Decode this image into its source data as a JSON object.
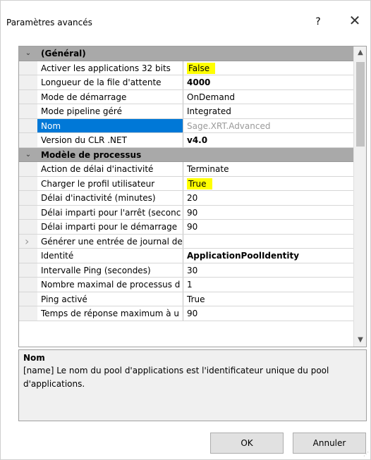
{
  "window": {
    "title": "Paramètres avancés",
    "help_label": "?",
    "close_label": "✕"
  },
  "grid": {
    "sections": [
      {
        "category": "(Général)",
        "expanded": true,
        "rows": [
          {
            "name": "Activer les applications 32 bits",
            "value": "False",
            "highlighted": true
          },
          {
            "name": "Longueur de la file d'attente",
            "value": "4000",
            "bold": true
          },
          {
            "name": "Mode de démarrage",
            "value": "OnDemand"
          },
          {
            "name": "Mode pipeline géré",
            "value": "Integrated"
          },
          {
            "name": "Nom",
            "value": "Sage.XRT.Advanced",
            "selected": true,
            "disabled": true
          },
          {
            "name": "Version du CLR .NET",
            "value": "v4.0",
            "bold": true
          }
        ]
      },
      {
        "category": "Modèle de processus",
        "expanded": true,
        "rows": [
          {
            "name": "Action de délai d'inactivité",
            "value": "Terminate"
          },
          {
            "name": "Charger le profil utilisateur",
            "value": "True",
            "highlighted": true
          },
          {
            "name": "Délai d'inactivité (minutes)",
            "value": "20"
          },
          {
            "name": "Délai imparti pour l'arrêt (seconc",
            "value": "90"
          },
          {
            "name": "Délai imparti pour le démarrage",
            "value": "90"
          },
          {
            "name": "Générer une entrée de journal de",
            "value": "",
            "expander": true
          },
          {
            "name": "Identité",
            "value": "ApplicationPoolIdentity",
            "bold": true
          },
          {
            "name": "Intervalle Ping (secondes)",
            "value": "30"
          },
          {
            "name": "Nombre maximal de processus d",
            "value": "1"
          },
          {
            "name": "Ping activé",
            "value": "True"
          },
          {
            "name": "Temps de réponse maximum à u",
            "value": "90"
          }
        ]
      }
    ],
    "scroll_up": "▲",
    "scroll_down": "▼"
  },
  "description": {
    "title": "Nom",
    "text": "[name] Le nom du pool d'applications est l'identificateur unique du pool d'applications."
  },
  "buttons": {
    "ok": "OK",
    "cancel": "Annuler"
  },
  "colors": {
    "selection": "#0078d7",
    "highlight": "#ffff00",
    "category_bg": "#a9a9a9"
  }
}
